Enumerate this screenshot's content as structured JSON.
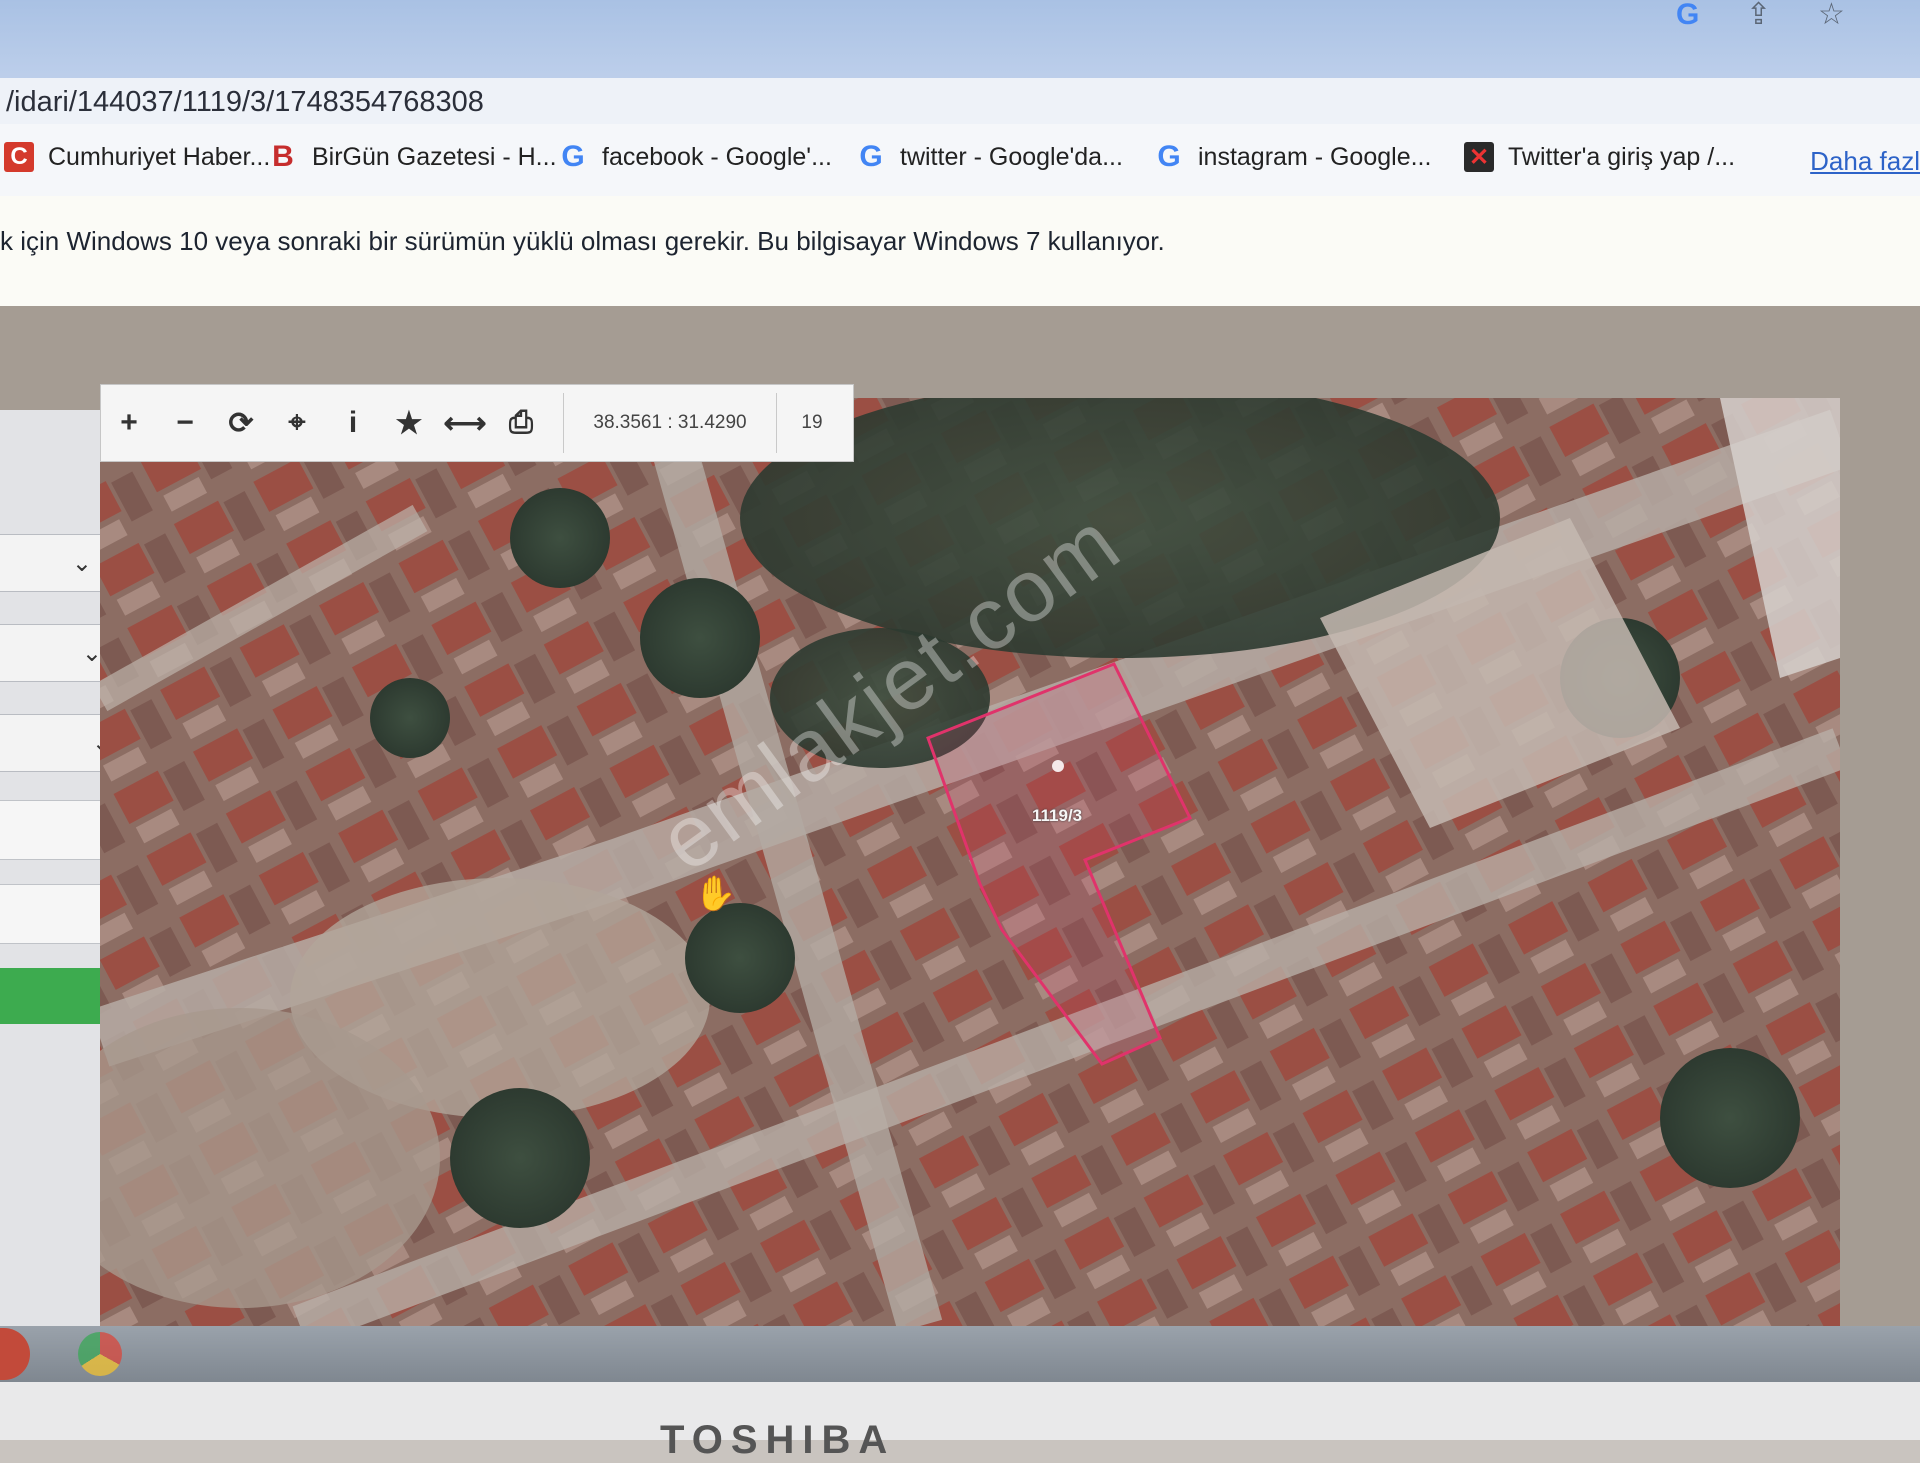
{
  "browser": {
    "address": "/idari/144037/1119/3/1748354768308",
    "more_link": "Daha fazl",
    "icons": [
      "google-icon",
      "share-icon",
      "star-icon"
    ],
    "bookmarks": [
      {
        "label": "Cumhuriyet Haber...",
        "icon": "cumhuriyet-icon"
      },
      {
        "label": "BirGün Gazetesi - H...",
        "icon": "birgun-icon"
      },
      {
        "label": "facebook - Google'...",
        "icon": "google-icon"
      },
      {
        "label": "twitter - Google'da...",
        "icon": "google-icon"
      },
      {
        "label": "instagram - Google...",
        "icon": "google-icon"
      },
      {
        "label": "Twitter'a giriş yap /...",
        "icon": "twitter-x-icon"
      }
    ],
    "info_message": "k için Windows 10 veya sonraki bir sürümün yüklü olması gerekir. Bu bilgisayar Windows 7 kullanıyor."
  },
  "map_toolbar": {
    "tools": [
      {
        "name": "zoom-in-icon",
        "glyph": "+"
      },
      {
        "name": "zoom-out-icon",
        "glyph": "−"
      },
      {
        "name": "refresh-icon",
        "glyph": "⟳"
      },
      {
        "name": "locate-icon",
        "glyph": "⌖"
      },
      {
        "name": "info-icon",
        "glyph": "i"
      },
      {
        "name": "favorite-star-icon",
        "glyph": "★"
      },
      {
        "name": "measure-icon",
        "glyph": "⟷"
      },
      {
        "name": "print-icon",
        "glyph": "⎙"
      }
    ],
    "coordinates": "38.3561 : 31.4290",
    "zoom_level": "19"
  },
  "map": {
    "parcel_label": "1119/3",
    "watermark": "emlakjet.com",
    "parcel_color": "#e0336b",
    "cursor_icon": "hand-cursor-icon"
  },
  "device": {
    "brand": "TOSHIBA"
  }
}
